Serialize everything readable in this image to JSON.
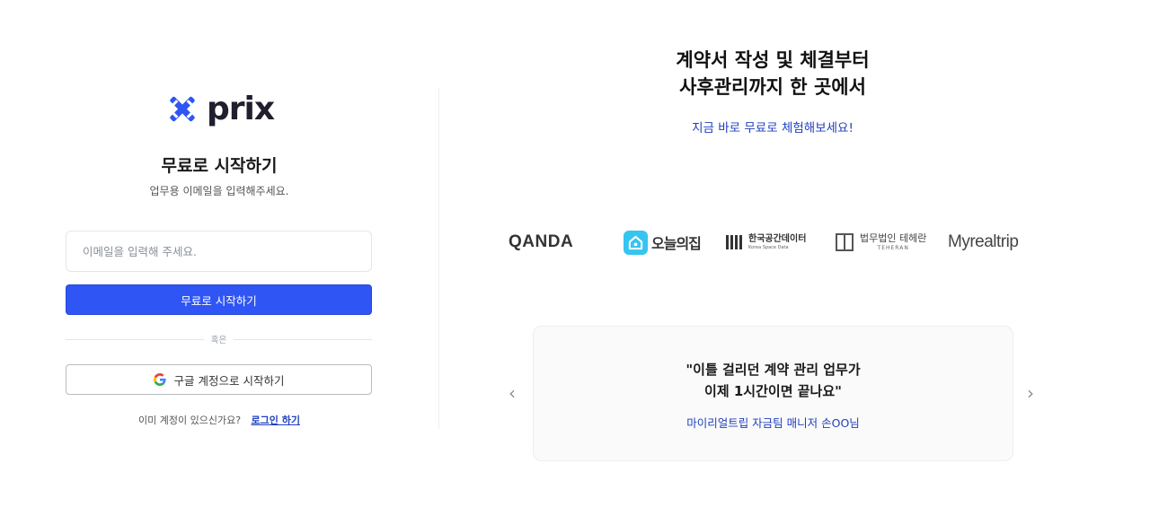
{
  "brand": {
    "name": "prix"
  },
  "signup": {
    "title": "무료로 시작하기",
    "subtitle": "업무용 이메일을 입력해주세요.",
    "email_placeholder": "이메일을 입력해 주세요.",
    "submit_label": "무료로 시작하기",
    "divider_label": "혹은",
    "google_label": "구글 계정으로 시작하기",
    "existing_account_text": "이미 계정이 있으신가요?",
    "login_link": "로그인 하기"
  },
  "promo": {
    "headline_line1": "계약서 작성 및 체결부터",
    "headline_line2": "사후관리까지 한 곳에서",
    "cta": "지금 바로 무료로 체험해보세요!"
  },
  "client_logos": {
    "qanda": "QANDA",
    "ohouse": "오늘의집",
    "kspace_ko": "한국공간데이터",
    "kspace_en": "Korea Space Data",
    "teheran_ko": "법무법인 테헤란",
    "teheran_en": "TEHERAN",
    "myrealtrip": "Myrealtrip"
  },
  "testimonial": {
    "quote_line1": "\"이틀 걸리던 계약 관리 업무가",
    "quote_line2": "이제 1시간이면 끝나요\"",
    "author": "마이리얼트립 자금팀 매니저 손OO님",
    "prev_arrow": "‹",
    "next_arrow": "›"
  },
  "colors": {
    "primary": "#2f55f4",
    "link": "#1f3fbf",
    "logo_blue": "#2f55f4"
  }
}
